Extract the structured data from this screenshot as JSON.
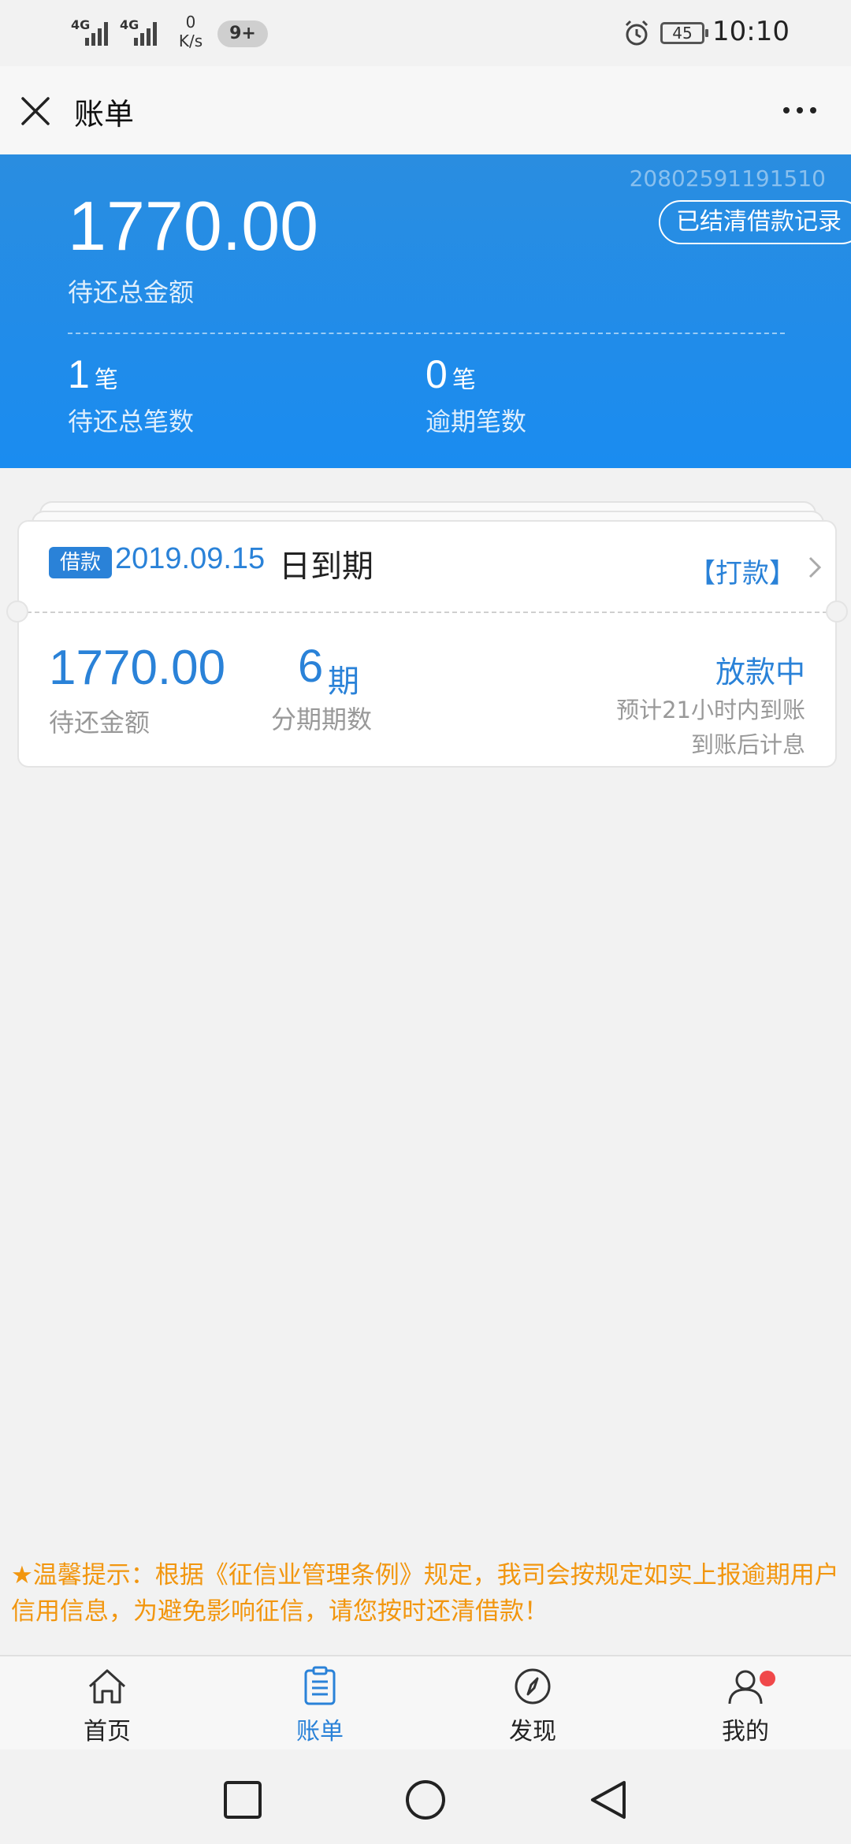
{
  "status_bar": {
    "net1": "4G",
    "net2": "4G",
    "speed_value": "0",
    "speed_unit": "K/s",
    "notif_badge": "9+",
    "battery": "45",
    "time": "10:10"
  },
  "nav": {
    "title": "账单"
  },
  "summary": {
    "account_no": "20802591191510",
    "history_button": "已结清借款记录",
    "total_amount": "1770.00",
    "total_label": "待还总金额",
    "pending_count": "1",
    "pending_unit": "笔",
    "pending_label": "待还总笔数",
    "overdue_count": "0",
    "overdue_unit": "笔",
    "overdue_label": "逾期笔数"
  },
  "loan_card": {
    "tag": "借款",
    "due_date": "2019.09.15",
    "due_suffix": "日到期",
    "transfer_link": "【打款】",
    "amount": "1770.00",
    "amount_label": "待还金额",
    "periods": "6",
    "periods_unit": "期",
    "periods_label": "分期期数",
    "status": "放款中",
    "eta": "预计21小时内到账",
    "note": "到账后计息"
  },
  "tip": "★温馨提示：根据《征信业管理条例》规定，我司会按规定如实上报逾期用户信用信息，为避免影响征信，请您按时还清借款！",
  "tabs": [
    {
      "label": "首页",
      "icon": "home-icon"
    },
    {
      "label": "账单",
      "icon": "bill-icon"
    },
    {
      "label": "发现",
      "icon": "compass-icon"
    },
    {
      "label": "我的",
      "icon": "user-icon"
    }
  ],
  "colors": {
    "brand_blue": "#2a82d8",
    "header_blue": "#1a8cf0",
    "tip_orange": "#f2960f",
    "badge_red": "#f0484a"
  }
}
